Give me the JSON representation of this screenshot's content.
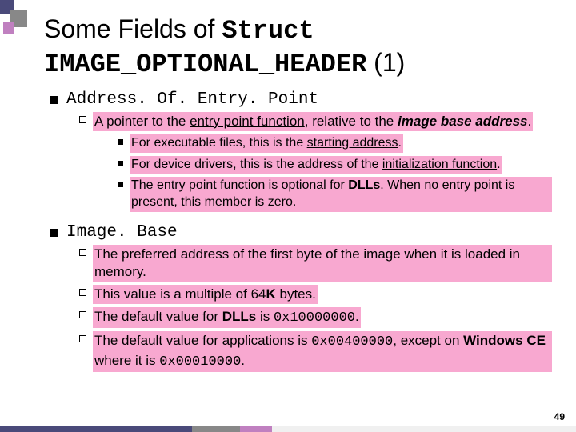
{
  "title": {
    "part1": "Some Fields of ",
    "code1": "Struct",
    "code2": "IMAGE_OPTIONAL_HEADER",
    "suffix": " (1)"
  },
  "sections": [
    {
      "heading": "Address. Of. Entry. Point",
      "items": [
        {
          "html": "A pointer to the <u>entry point function</u>, relative to the <b><i>image base address</i></b>.",
          "sub": [
            {
              "html": "For executable files, this is the <u>starting address</u>."
            },
            {
              "html": "For device drivers, this is the address of the <u>initialization function</u>."
            },
            {
              "html": "The entry point function is optional for <b>DLLs</b>. When no entry point is present, this member is zero."
            }
          ]
        }
      ]
    },
    {
      "heading": "Image. Base",
      "items": [
        {
          "html": "The preferred address of the first byte of the image when it is loaded in memory."
        },
        {
          "html": "This value is a multiple of 64<b>K</b> bytes."
        },
        {
          "html": "The default value for <b>DLLs</b> is <span class=\"mono-inline\">0x10000000</span>."
        },
        {
          "html": "The default value for applications is <span class=\"mono-inline\">0x00400000</span>, except on <b>Windows CE</b> where it is <span class=\"mono-inline\">0x00010000</span>."
        }
      ]
    }
  ],
  "pagenum": "49"
}
